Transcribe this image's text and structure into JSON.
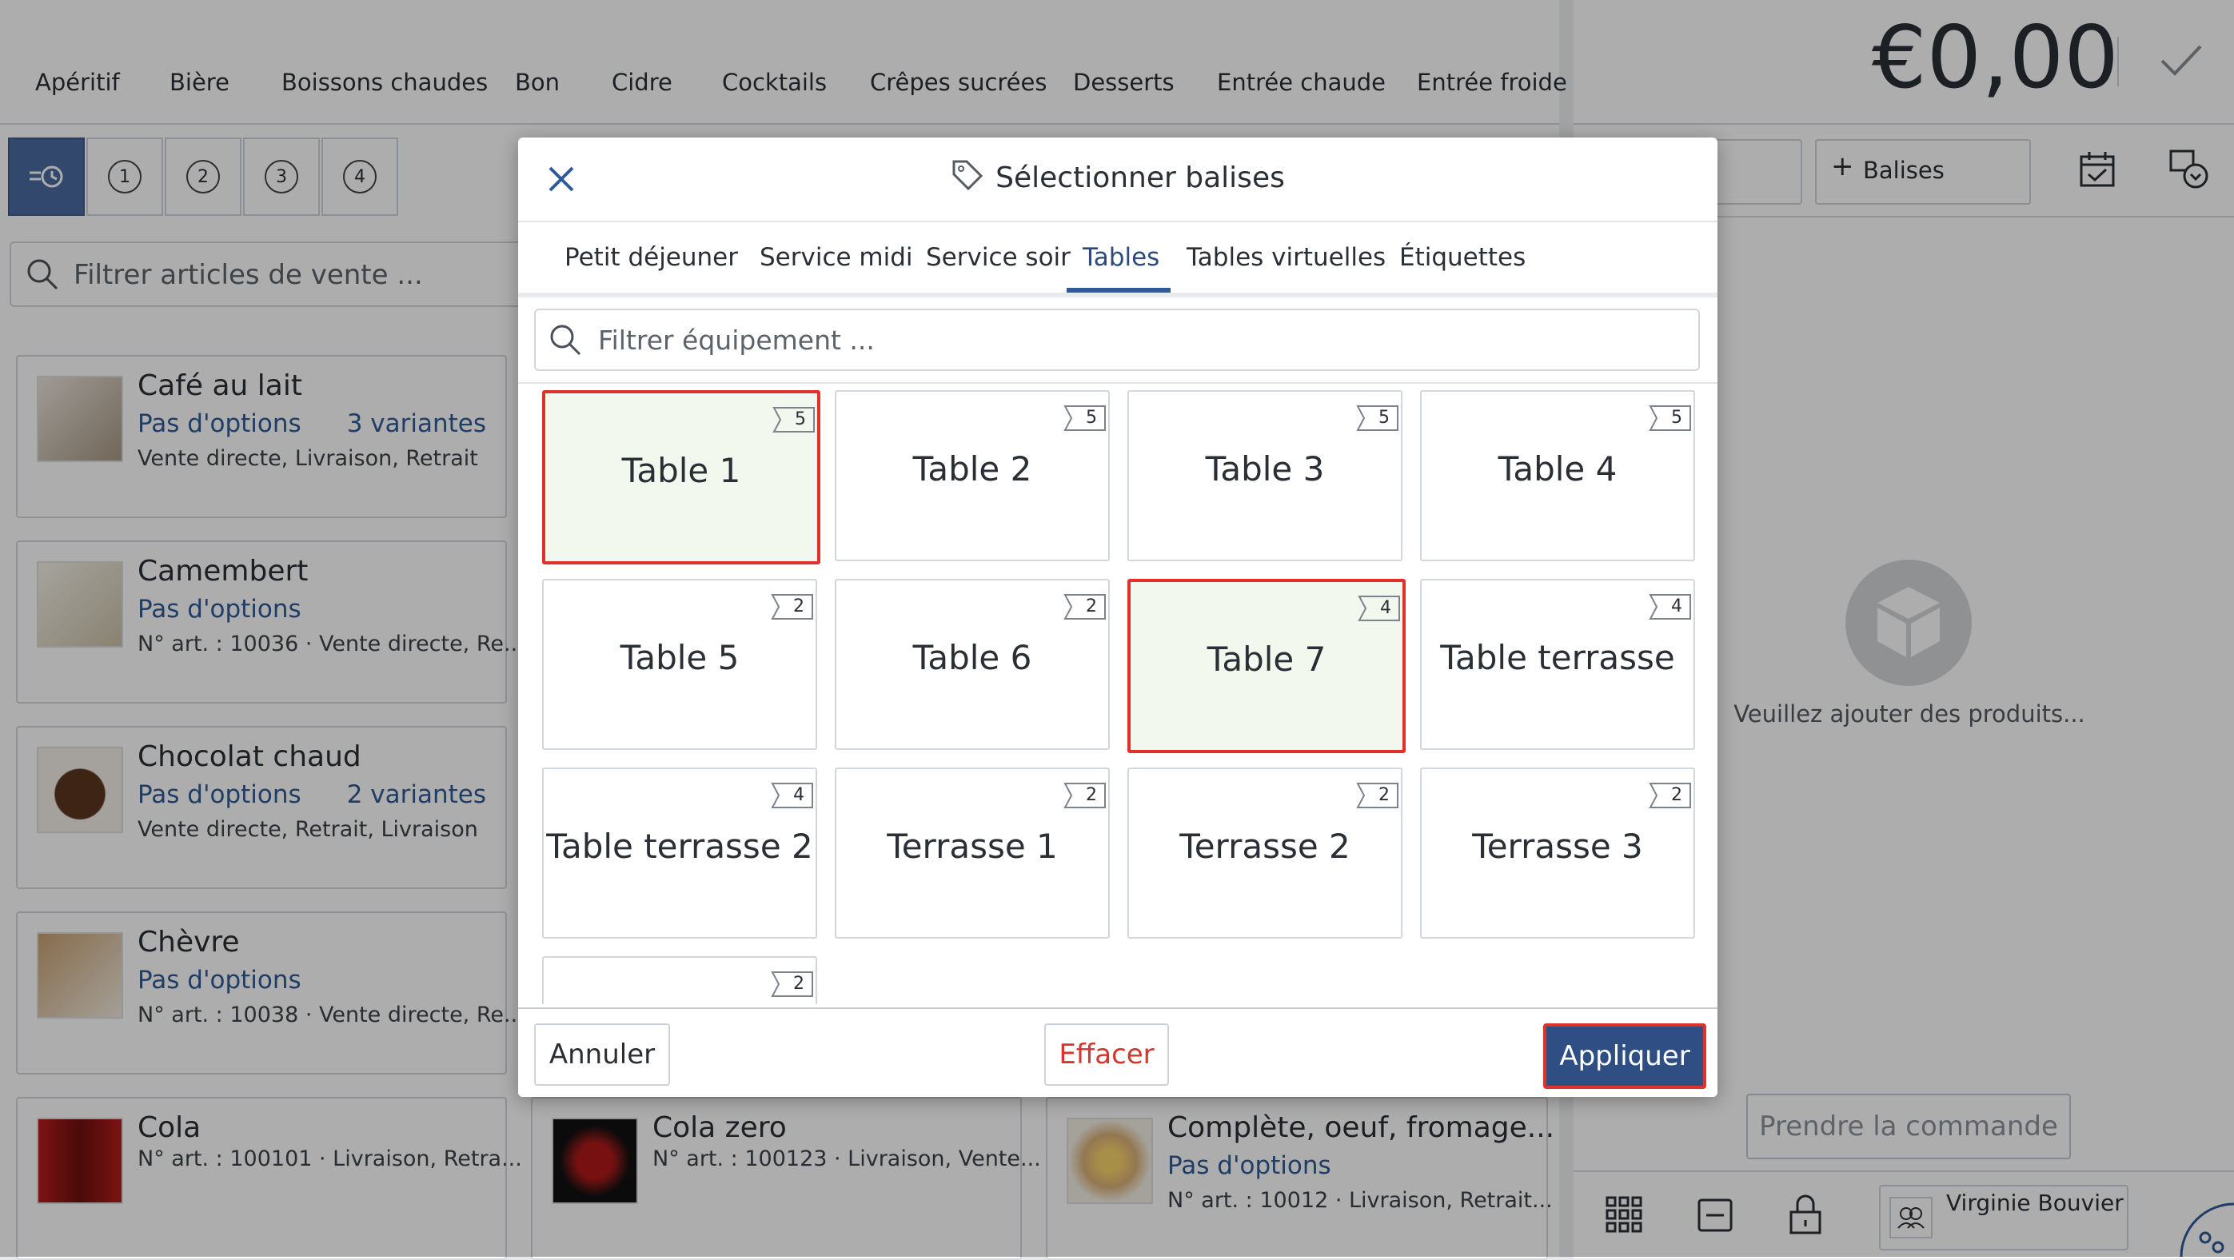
{
  "categories": [
    "Apéritif",
    "Bière",
    "Boissons chaudes",
    "Bon",
    "Cidre",
    "Cocktails",
    "Crêpes sucrées",
    "Desserts",
    "Entrée chaude",
    "Entrée froide"
  ],
  "view_buttons": [
    "1",
    "2",
    "3",
    "4"
  ],
  "article_search": {
    "placeholder": "Filtrer articles de vente ..."
  },
  "articles": [
    {
      "name": "Café au lait",
      "options": "Pas d'options",
      "variants": "3 variantes",
      "meta": "Vente directe, Livraison, Retrait"
    },
    {
      "name": "Camembert",
      "options": "Pas d'options",
      "variants": "",
      "meta": "N° art. : 10036 · Vente directe, Re..."
    },
    {
      "name": "Chocolat chaud",
      "options": "Pas d'options",
      "variants": "2 variantes",
      "meta": "Vente directe, Retrait, Livraison"
    },
    {
      "name": "Chèvre",
      "options": "Pas d'options",
      "variants": "",
      "meta": "N° art. : 10038 · Vente directe, Re..."
    },
    {
      "name": "Cola",
      "options": "",
      "variants": "",
      "meta": "N° art. : 100101 · Livraison, Retra..."
    },
    {
      "name": "Cola zero",
      "options": "",
      "variants": "",
      "meta": "N° art. : 100123 · Livraison, Vente..."
    },
    {
      "name": "Complète, oeuf, fromage...",
      "options": "Pas d'options",
      "variants": "",
      "meta": "N° art. : 10012 · Livraison, Retrait..."
    }
  ],
  "order": {
    "total": "€0,00",
    "tags_button": "Balises",
    "empty_message": "Veuillez ajouter des produits...",
    "take_order": "Prendre la commande",
    "user": "Virginie Bouvier"
  },
  "dialog": {
    "title": "Sélectionner balises",
    "tabs": [
      "Petit déjeuner",
      "Service midi",
      "Service soir",
      "Tables",
      "Tables virtuelles",
      "Étiquettes"
    ],
    "active_tab": "Tables",
    "filter_placeholder": "Filtrer équipement ...",
    "tables": [
      {
        "name": "Table 1",
        "seats": "5",
        "selected": true
      },
      {
        "name": "Table 2",
        "seats": "5",
        "selected": false
      },
      {
        "name": "Table 3",
        "seats": "5",
        "selected": false
      },
      {
        "name": "Table 4",
        "seats": "5",
        "selected": false
      },
      {
        "name": "Table 5",
        "seats": "2",
        "selected": false
      },
      {
        "name": "Table 6",
        "seats": "2",
        "selected": false
      },
      {
        "name": "Table 7",
        "seats": "4",
        "selected": true
      },
      {
        "name": "Table terrasse",
        "seats": "4",
        "selected": false
      },
      {
        "name": "Table terrasse 2",
        "seats": "4",
        "selected": false
      },
      {
        "name": "Terrasse 1",
        "seats": "2",
        "selected": false
      },
      {
        "name": "Terrasse 2",
        "seats": "2",
        "selected": false
      },
      {
        "name": "Terrasse 3",
        "seats": "2",
        "selected": false
      },
      {
        "name": "",
        "seats": "2",
        "selected": false
      }
    ],
    "cancel": "Annuler",
    "clear": "Effacer",
    "apply": "Appliquer"
  },
  "colors": {
    "accent": "#2f4e84",
    "selected_border": "#e0312b",
    "selected_fill": "#f3f8ee",
    "clear_text": "#d1362f"
  }
}
